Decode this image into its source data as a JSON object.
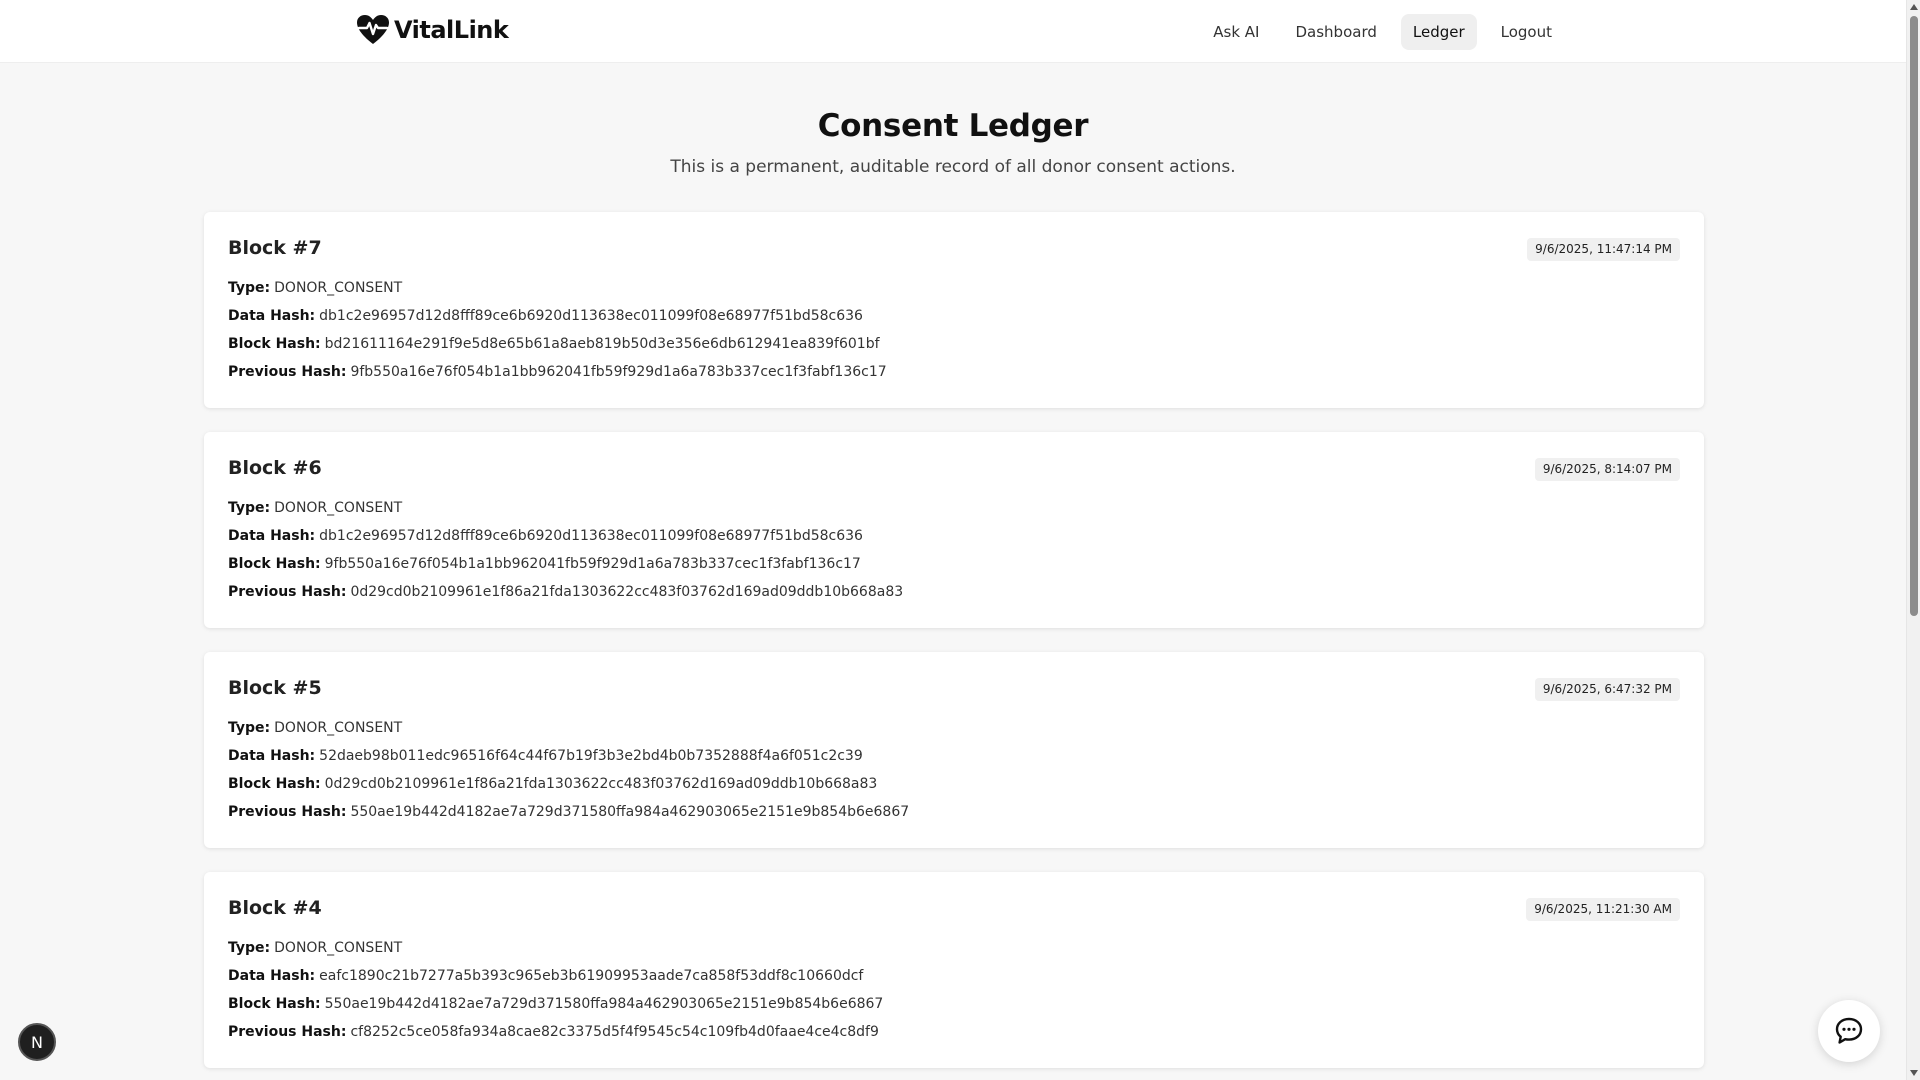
{
  "app": {
    "name": "VitalLink"
  },
  "nav": {
    "items": [
      {
        "label": "Ask AI",
        "active": false
      },
      {
        "label": "Dashboard",
        "active": false
      },
      {
        "label": "Ledger",
        "active": true
      },
      {
        "label": "Logout",
        "active": false
      }
    ]
  },
  "page": {
    "title": "Consent Ledger",
    "subtitle": "This is a permanent, auditable record of all donor consent actions."
  },
  "labels": {
    "type": "Type:",
    "data_hash": "Data Hash:",
    "block_hash": "Block Hash:",
    "previous_hash": "Previous Hash:"
  },
  "blocks": [
    {
      "title": "Block #7",
      "timestamp": "9/6/2025, 11:47:14 PM",
      "type": "DONOR_CONSENT",
      "data_hash": "db1c2e96957d12d8fff89ce6b6920d113638ec011099f08e68977f51bd58c636",
      "block_hash": "bd21611164e291f9e5d8e65b61a8aeb819b50d3e356e6db612941ea839f601bf",
      "previous_hash": "9fb550a16e76f054b1a1bb962041fb59f929d1a6a783b337cec1f3fabf136c17"
    },
    {
      "title": "Block #6",
      "timestamp": "9/6/2025, 8:14:07 PM",
      "type": "DONOR_CONSENT",
      "data_hash": "db1c2e96957d12d8fff89ce6b6920d113638ec011099f08e68977f51bd58c636",
      "block_hash": "9fb550a16e76f054b1a1bb962041fb59f929d1a6a783b337cec1f3fabf136c17",
      "previous_hash": "0d29cd0b2109961e1f86a21fda1303622cc483f03762d169ad09ddb10b668a83"
    },
    {
      "title": "Block #5",
      "timestamp": "9/6/2025, 6:47:32 PM",
      "type": "DONOR_CONSENT",
      "data_hash": "52daeb98b011edc96516f64c44f67b19f3b3e2bd4b0b7352888f4a6f051c2c39",
      "block_hash": "0d29cd0b2109961e1f86a21fda1303622cc483f03762d169ad09ddb10b668a83",
      "previous_hash": "550ae19b442d4182ae7a729d371580ffa984a462903065e2151e9b854b6e6867"
    },
    {
      "title": "Block #4",
      "timestamp": "9/6/2025, 11:21:30 AM",
      "type": "DONOR_CONSENT",
      "data_hash": "eafc1890c21b7277a5b393c965eb3b61909953aade7ca858f53ddf8c10660dcf",
      "block_hash": "550ae19b442d4182ae7a729d371580ffa984a462903065e2151e9b854b6e6867",
      "previous_hash": "cf8252c5ce058fa934a8cae82c3375d5f4f9545c54c109fb4d0faae4ce4c8df9"
    }
  ],
  "floating": {
    "dev_badge": "N",
    "chat_icon": "chat-bubble-icon"
  },
  "colors": {
    "background": "#f7f7f7",
    "card": "#ffffff",
    "active_nav": "#efefef",
    "text": "#1a1a1a"
  }
}
